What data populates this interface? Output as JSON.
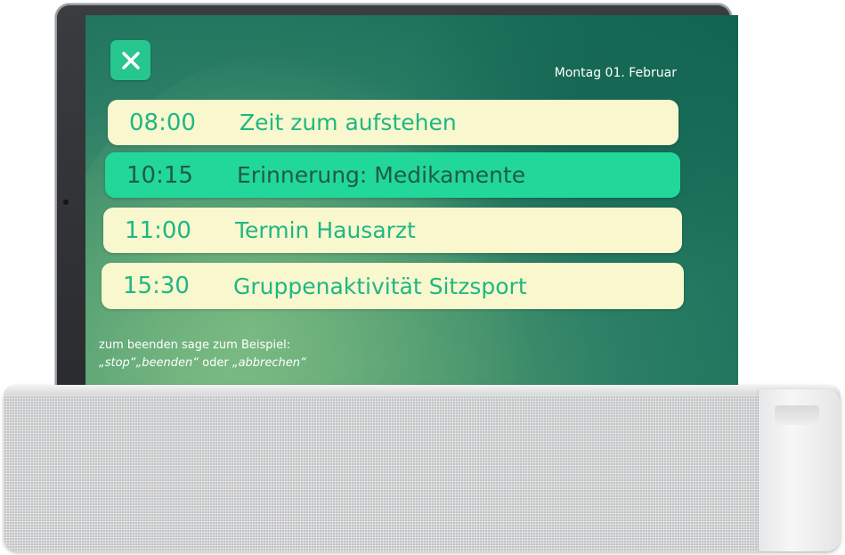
{
  "screen": {
    "date": "Montag 01. Februar",
    "close_icon": "close-icon",
    "events": [
      {
        "time": "08:00",
        "label": "Zeit zum aufstehen",
        "active": false
      },
      {
        "time": "10:15",
        "label": "Erinnerung: Medikamente",
        "active": true
      },
      {
        "time": "11:00",
        "label": "Termin Hausarzt",
        "active": false
      },
      {
        "time": "15:30",
        "label": "Gruppenaktivität Sitzsport",
        "active": false
      }
    ],
    "hint": {
      "line1": "zum beenden sage zum Beispiel:",
      "stop": "„stop“",
      "beenden": "„beenden“",
      "oder": " oder ",
      "abbrechen": "„abbrechen“"
    }
  },
  "colors": {
    "accent": "#22d79a",
    "card": "#f8f7ce",
    "text_green": "#1fb784",
    "text_dark": "#1d5c49"
  }
}
